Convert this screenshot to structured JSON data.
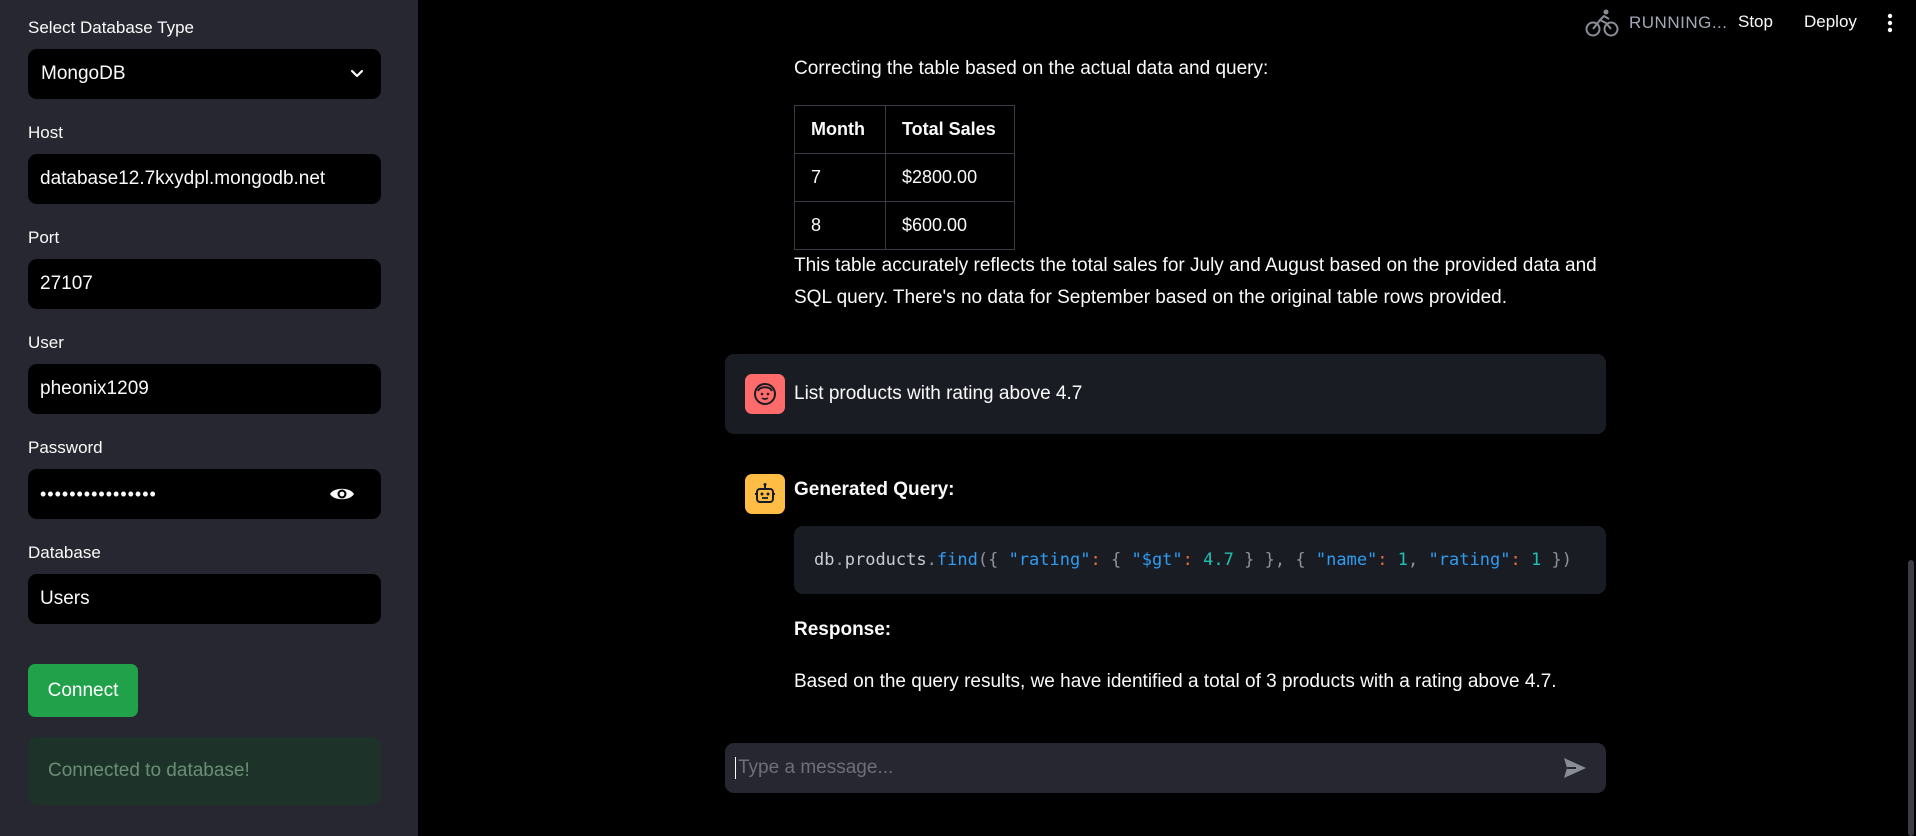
{
  "sidebar": {
    "db_type_label": "Select Database Type",
    "db_type_value": "MongoDB",
    "host_label": "Host",
    "host_value": "database12.7kxydpl.mongodb.net",
    "port_label": "Port",
    "port_value": "27107",
    "user_label": "User",
    "user_value": "pheonix1209",
    "password_label": "Password",
    "password_masked": "••••••••••••••••",
    "database_label": "Database",
    "database_value": "Users",
    "connect_label": "Connect",
    "status_text": "Connected to database!"
  },
  "header": {
    "running_text": "RUNNING...",
    "stop_label": "Stop",
    "deploy_label": "Deploy"
  },
  "chat": {
    "intro": "Correcting the table based on the actual data and query:",
    "table": {
      "headers": [
        "Month",
        "Total Sales"
      ],
      "rows": [
        [
          "7",
          "$2800.00"
        ],
        [
          "8",
          "$600.00"
        ]
      ]
    },
    "summary": "This table accurately reflects the total sales for July and August based on the provided data and SQL query. There's no data for September based on the original table rows provided.",
    "user_message": "List products with rating above 4.7",
    "generated_query_label": "Generated Query:",
    "query_code": "db.products.find({ \"rating\": { \"$gt\": 4.7 } }, { \"name\": 1, \"rating\": 1 })",
    "response_label": "Response:",
    "response_text": "Based on the query results, we have identified a total of 3 products with a rating above 4.7.",
    "input_placeholder": "Type a message..."
  },
  "colors": {
    "sidebar_bg": "#262730",
    "connect_green": "#21a14a",
    "user_avatar": "#ff6b6b",
    "bot_avatar": "#ffbd45"
  },
  "icons": [
    "chevron-down-icon",
    "eye-icon",
    "running-bike-icon",
    "kebab-menu-icon",
    "user-avatar-icon",
    "bot-avatar-icon",
    "send-icon"
  ]
}
